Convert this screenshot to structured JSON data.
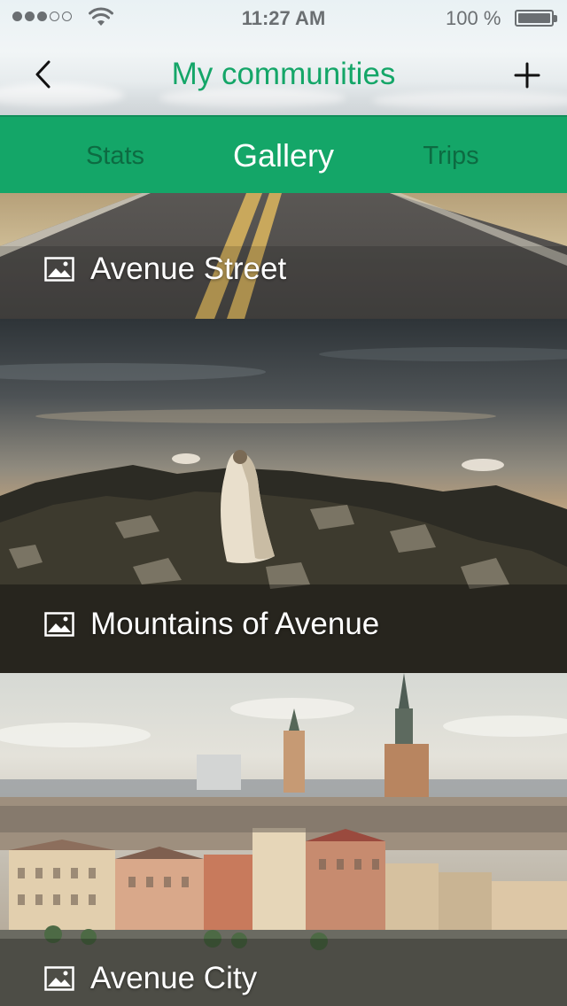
{
  "status_bar": {
    "time": "11:27 AM",
    "battery": "100 %",
    "signal_bars_filled": 3,
    "signal_bars_total": 5
  },
  "nav": {
    "title": "My communities",
    "back_icon": "chevron-left-icon",
    "add_icon": "plus-icon"
  },
  "tabs": [
    {
      "label": "Stats",
      "active": false
    },
    {
      "label": "Gallery",
      "active": true
    },
    {
      "label": "Trips",
      "active": false
    }
  ],
  "gallery": [
    {
      "title": "Avenue Street",
      "icon": "image-icon"
    },
    {
      "title": "Mountains of Avenue",
      "icon": "image-icon"
    },
    {
      "title": "Avenue City",
      "icon": "image-icon"
    }
  ],
  "colors": {
    "accent": "#14a668",
    "tab_inactive": "#0d6b42",
    "status_text": "#6b6f72"
  }
}
